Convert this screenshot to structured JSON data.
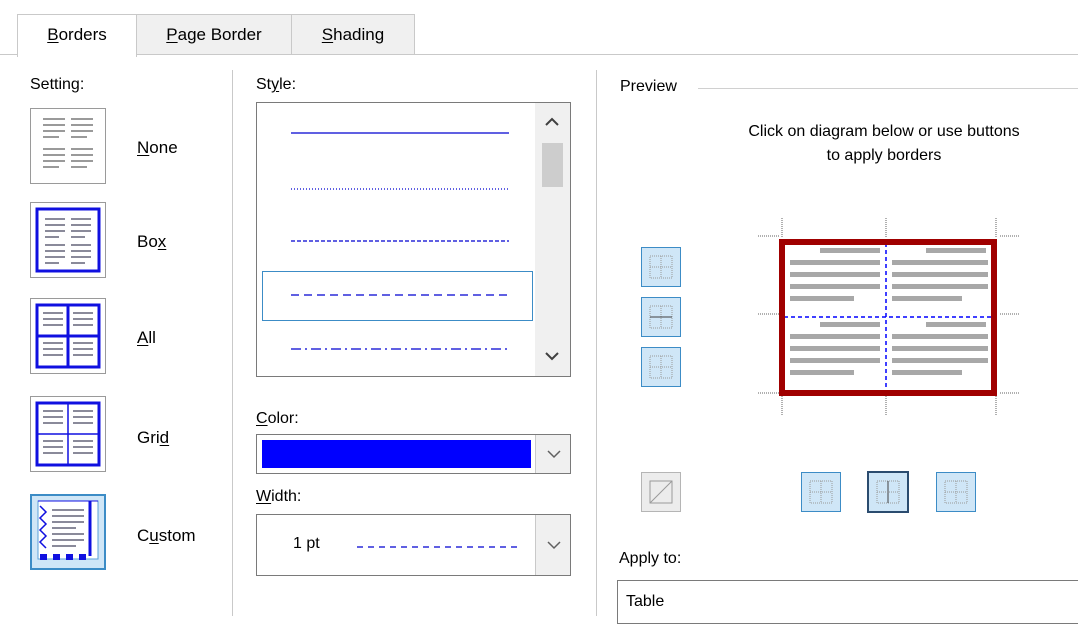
{
  "tabs": [
    {
      "label": "Borders",
      "accel": "B",
      "rest": "orders"
    },
    {
      "label": "Page Border",
      "accel": "P",
      "rest": "age Border"
    },
    {
      "label": "Shading",
      "accel": "S",
      "rest": "hading"
    }
  ],
  "setting": {
    "label": "Setting:",
    "options": [
      {
        "pre": "",
        "accel": "N",
        "post": "one"
      },
      {
        "pre": "Bo",
        "accel": "x",
        "post": ""
      },
      {
        "pre": "",
        "accel": "A",
        "post": "ll"
      },
      {
        "pre": "Gri",
        "accel": "d",
        "post": ""
      },
      {
        "pre": "C",
        "accel": "u",
        "post": "stom"
      }
    ]
  },
  "style": {
    "label_pre": "St",
    "label_accel": "y",
    "label_post": "le:"
  },
  "color": {
    "label_accel": "C",
    "label_post": "olor:",
    "value": "#0000ff"
  },
  "width": {
    "label_accel": "W",
    "label_post": "idth:",
    "value": "1 pt"
  },
  "preview": {
    "label": "Preview",
    "instruction_line1": "Click on diagram below or use buttons",
    "instruction_line2": "to apply borders",
    "border_color": "#a00000",
    "line_color": "#0000ff"
  },
  "apply_to": {
    "label": "Apply to:",
    "value": "Table"
  }
}
